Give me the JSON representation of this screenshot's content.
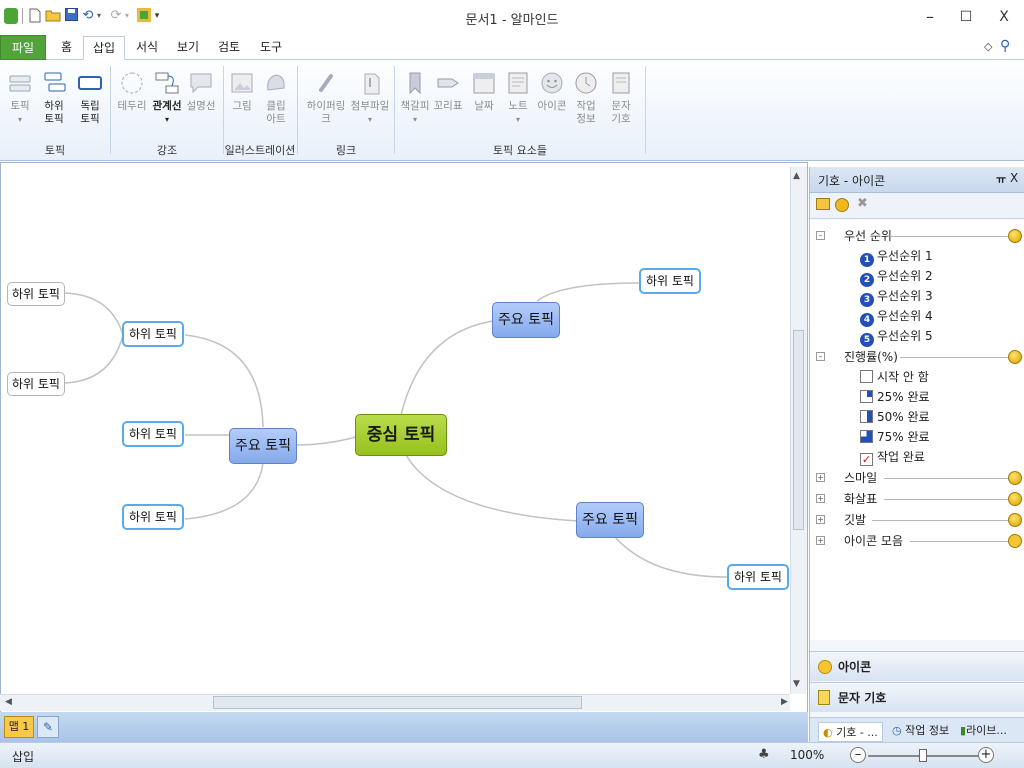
{
  "window": {
    "title": "문서1 - 알마인드",
    "min": "–",
    "max": "☐",
    "close": "X"
  },
  "qat": [
    "⟲",
    "▾"
  ],
  "menu_tabs": [
    "파일",
    "홈",
    "삽입",
    "서식",
    "보기",
    "검토",
    "도구"
  ],
  "ribbon": {
    "groups": [
      "토픽",
      "강조",
      "일러스트레이션",
      "링크",
      "토픽 요소들"
    ],
    "buttons": [
      {
        "label": "토픽",
        "state": "disabled"
      },
      {
        "label": "하위\n토픽",
        "state": "enabled"
      },
      {
        "label": "독립\n토픽",
        "state": "enabled"
      },
      {
        "label": "테두리",
        "state": "disabled"
      },
      {
        "label": "관계선",
        "state": "enabled"
      },
      {
        "label": "설명선",
        "state": "disabled"
      },
      {
        "label": "그림",
        "state": "disabled"
      },
      {
        "label": "클립\n아트",
        "state": "disabled"
      },
      {
        "label": "하이퍼링크",
        "state": "disabled"
      },
      {
        "label": "첨부파일",
        "state": "disabled"
      },
      {
        "label": "책갈피",
        "state": "disabled"
      },
      {
        "label": "꼬리표",
        "state": "disabled"
      },
      {
        "label": "날짜",
        "state": "disabled"
      },
      {
        "label": "노트",
        "state": "disabled"
      },
      {
        "label": "아이콘",
        "state": "disabled"
      },
      {
        "label": "작업\n정보",
        "state": "disabled"
      },
      {
        "label": "문자\n기호",
        "state": "disabled"
      }
    ]
  },
  "mindmap": {
    "center": "중심 토픽",
    "main_topics": [
      "주요 토픽",
      "주요 토픽",
      "주요 토픽"
    ],
    "sub_topics": [
      "하위 토픽",
      "하위 토픽",
      "하위 토픽",
      "하위 토픽",
      "하위 토픽"
    ],
    "leaf_topics": [
      "하위 토픽",
      "하위 토픽"
    ]
  },
  "sheet": {
    "tab": "맵 1"
  },
  "panel": {
    "title": "기호 - 아이콘",
    "pin": "ㅠ",
    "close": "X",
    "categories": [
      {
        "name": "우선 순위",
        "expanded": true,
        "items": [
          "우선순위 1",
          "우선순위 2",
          "우선순위 3",
          "우선순위 4",
          "우선순위 5"
        ],
        "badges": [
          "1",
          "2",
          "3",
          "4",
          "5"
        ]
      },
      {
        "name": "진행률(%)",
        "expanded": true,
        "items": [
          "시작 안 함",
          "25% 완료",
          "50% 완료",
          "75% 완료",
          "작업 완료"
        ],
        "progress": [
          0,
          0.25,
          0.5,
          0.75,
          1
        ]
      },
      {
        "name": "스마일",
        "expanded": false
      },
      {
        "name": "화살표",
        "expanded": false
      },
      {
        "name": "깃발",
        "expanded": false
      },
      {
        "name": "아이콘 모음",
        "expanded": false
      }
    ],
    "bottom_buttons": [
      "아이콘",
      "문자 기호"
    ],
    "tabs": [
      "기호 - ...",
      "작업 정보",
      "라이브..."
    ]
  },
  "status": {
    "mode": "삽입",
    "zoom": "100%",
    "zoom_level": 0.5
  },
  "colors": {
    "accent_green": "#53a33b",
    "center_topic": "#a8cf33",
    "main_topic": "#9ab9f3",
    "sub_border": "#5aa9ee"
  }
}
